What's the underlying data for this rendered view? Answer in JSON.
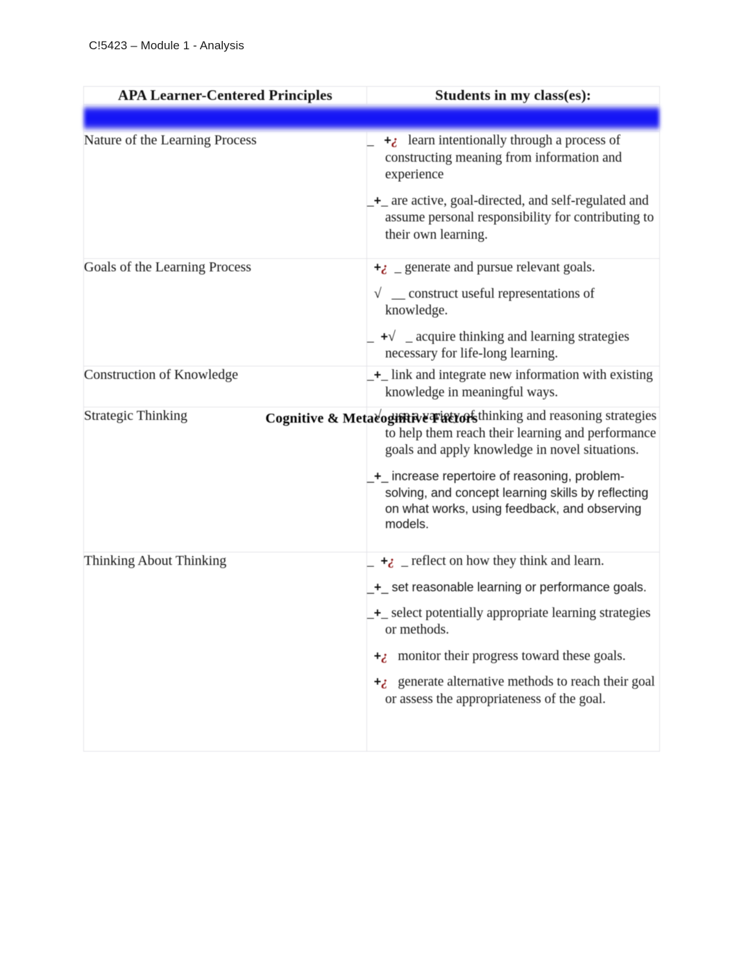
{
  "document": {
    "running_header": "C!5423 – Module 1 - Analysis"
  },
  "colors": {
    "banner_blue": "#1111f6",
    "marker_red": "#8d1111",
    "text_black": "#111111",
    "border_gray": "#e3e3e8"
  },
  "table": {
    "headers": {
      "col1": "APA Learner-Centered Principles",
      "col2": "Students in my class(es):"
    },
    "section_banner": "Cognitive & Metacognitive Factors",
    "rows": [
      {
        "principle": "Nature of the Learning Process",
        "items": [
          {
            "marker": "_   ",
            "marker_plus": "+",
            "marker_q": "¿",
            "marker_check": "",
            "marker_tail": "   ",
            "text": "learn intentionally through a process of constructing meaning from information and experience"
          },
          {
            "marker": "_",
            "marker_plus": "+",
            "marker_q": "",
            "marker_check": "",
            "marker_tail": "_ ",
            "text": "are active, goal-directed, and self-regulated and assume personal responsibility for contributing to their own learning."
          }
        ]
      },
      {
        "principle": "Goals of the Learning Process",
        "items": [
          {
            "marker": "  ",
            "marker_plus": "+",
            "marker_q": "¿",
            "marker_check": "",
            "marker_tail": "  _ ",
            "text": "generate and pursue relevant goals."
          },
          {
            "marker": "  ",
            "marker_plus": "",
            "marker_q": "",
            "marker_check": "√",
            "marker_tail": "   __ ",
            "text": "construct useful representations of knowledge."
          },
          {
            "marker": "_  ",
            "marker_plus": "+",
            "marker_q": "",
            "marker_check": "√",
            "marker_tail": "   _ ",
            "text": "acquire thinking and learning strategies necessary for life-long learning."
          }
        ]
      },
      {
        "principle": "Construction of Knowledge",
        "items": [
          {
            "marker": "_",
            "marker_plus": "+",
            "marker_q": "",
            "marker_check": "",
            "marker_tail": "_ ",
            "text": "link and integrate new information with existing knowledge in meaningful ways."
          }
        ]
      },
      {
        "principle": "Strategic Thinking",
        "items": [
          {
            "marker": "  ",
            "marker_plus": "",
            "marker_q": "",
            "marker_check": "√",
            "marker_tail": "   ",
            "text": "use a variety of thinking and reasoning strategies to help them reach their learning and performance goals and apply knowledge in novel situations."
          },
          {
            "marker": "_",
            "marker_plus": "+",
            "marker_q": "",
            "marker_check": "",
            "marker_tail": "_ ",
            "text": "increase repertoire of reasoning, problem-solving, and concept learning skills by reflecting on what works, using feedback, and observing models."
          }
        ]
      },
      {
        "principle": "Thinking About Thinking",
        "items": [
          {
            "marker": "_  ",
            "marker_plus": "+",
            "marker_q": "¿",
            "marker_check": "",
            "marker_tail": "  _ ",
            "text": "reflect on how they think and learn."
          },
          {
            "marker": "_",
            "marker_plus": "+",
            "marker_q": "",
            "marker_check": "",
            "marker_tail": "_ ",
            "text": "set reasonable learning or performance goals."
          },
          {
            "marker": "_",
            "marker_plus": "+",
            "marker_q": "",
            "marker_check": "",
            "marker_tail": "_ ",
            "text": "select potentially appropriate learning strategies or methods."
          },
          {
            "marker": "  ",
            "marker_plus": "+",
            "marker_q": "¿",
            "marker_check": "",
            "marker_tail": "   ",
            "text": "monitor their progress toward these goals."
          },
          {
            "marker": "  ",
            "marker_plus": "+",
            "marker_q": "¿",
            "marker_check": "",
            "marker_tail": "   ",
            "text": "generate alternative methods to reach their goal or assess the appropriateness of the goal."
          }
        ]
      }
    ]
  }
}
